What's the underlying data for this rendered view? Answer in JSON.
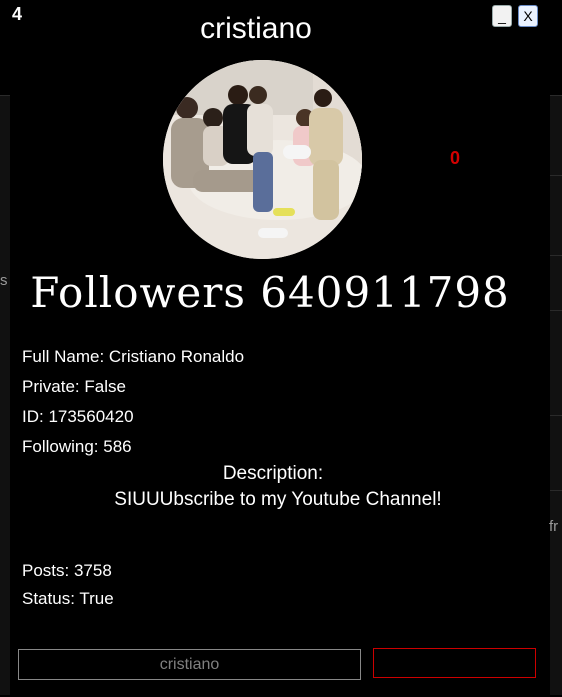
{
  "badge": "4",
  "window_buttons": {
    "minimize": "_",
    "close": "X"
  },
  "profile": {
    "username": "cristiano",
    "followers_text": "Followers 640911798",
    "counter": "0",
    "full_name": "Full Name: Cristiano Ronaldo",
    "private": "Private: False",
    "id": "ID: 173560420",
    "following": "Following: 586",
    "description_label": "Description:",
    "description": "SIUUUbscribe to my Youtube Channel!",
    "posts": "Posts: 3758",
    "status": "Status: True"
  },
  "inputs": {
    "username_value": "cristiano",
    "second_value": ""
  },
  "background_fragments": {
    "left": "s",
    "right": "fr"
  },
  "colors": {
    "background": "#000000",
    "counter": "#d40000",
    "input_border_right": "#cc0000"
  }
}
